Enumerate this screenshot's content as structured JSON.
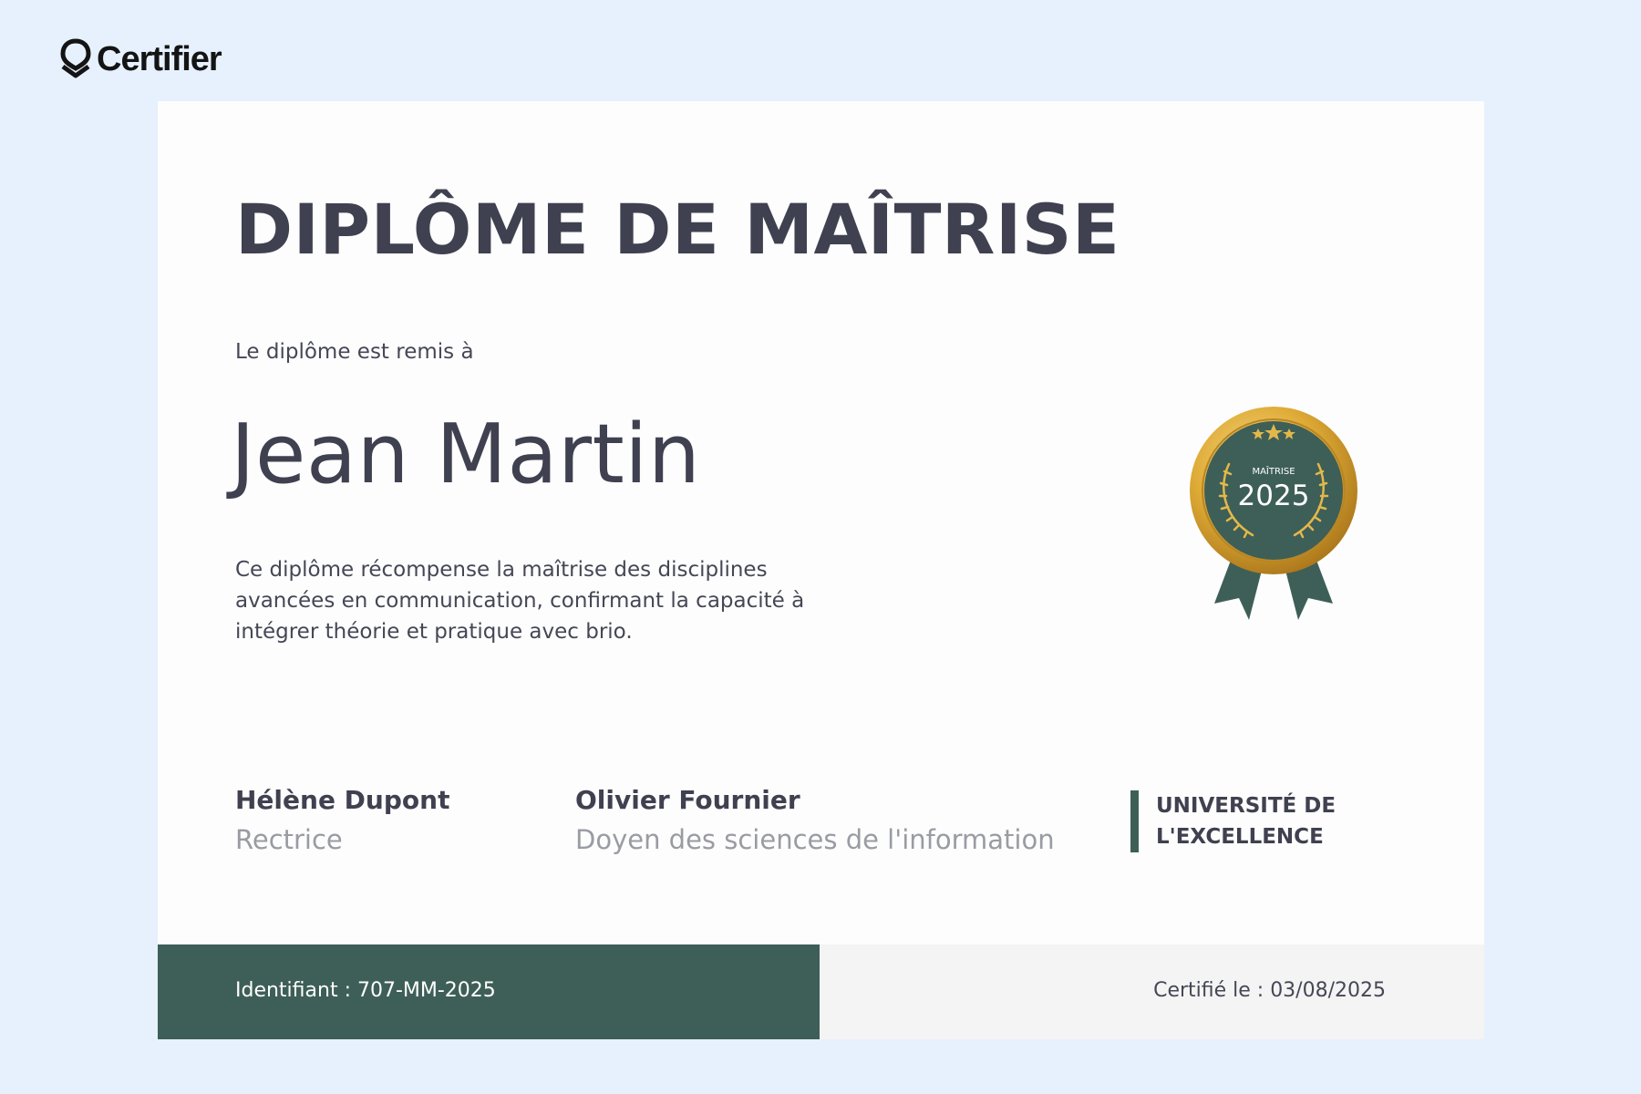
{
  "brand": {
    "name": "Certifier",
    "icon": "certifier-logo-icon"
  },
  "certificate": {
    "title": "DIPLÔME DE MAÎTRISE",
    "lead": "Le diplôme est remis à",
    "recipient": "Jean Martin",
    "description": "Ce diplôme récompense la maîtrise des disciplines avancées en communication, confirmant la capacité à intégrer théorie et pratique avec brio.",
    "badge": {
      "label": "MAÎTRISE",
      "year": "2025",
      "icon": "award-ribbon-icon"
    },
    "signers": [
      {
        "name": "Hélène Dupont",
        "role": "Rectrice"
      },
      {
        "name": "Olivier Fournier",
        "role": "Doyen des sciences de l'information"
      }
    ],
    "institution": "UNIVERSITÉ DE L'EXCELLENCE",
    "footer": {
      "identifier": "Identifiant : 707-MM-2025",
      "certified_date": "Certifié le : 03/08/2025"
    }
  },
  "colors": {
    "page_background": "#e7f1fd",
    "accent_green": "#3e5f57",
    "gold": "#d9a530",
    "text_dark": "#3f4150",
    "text_muted": "#9a9ba3"
  }
}
